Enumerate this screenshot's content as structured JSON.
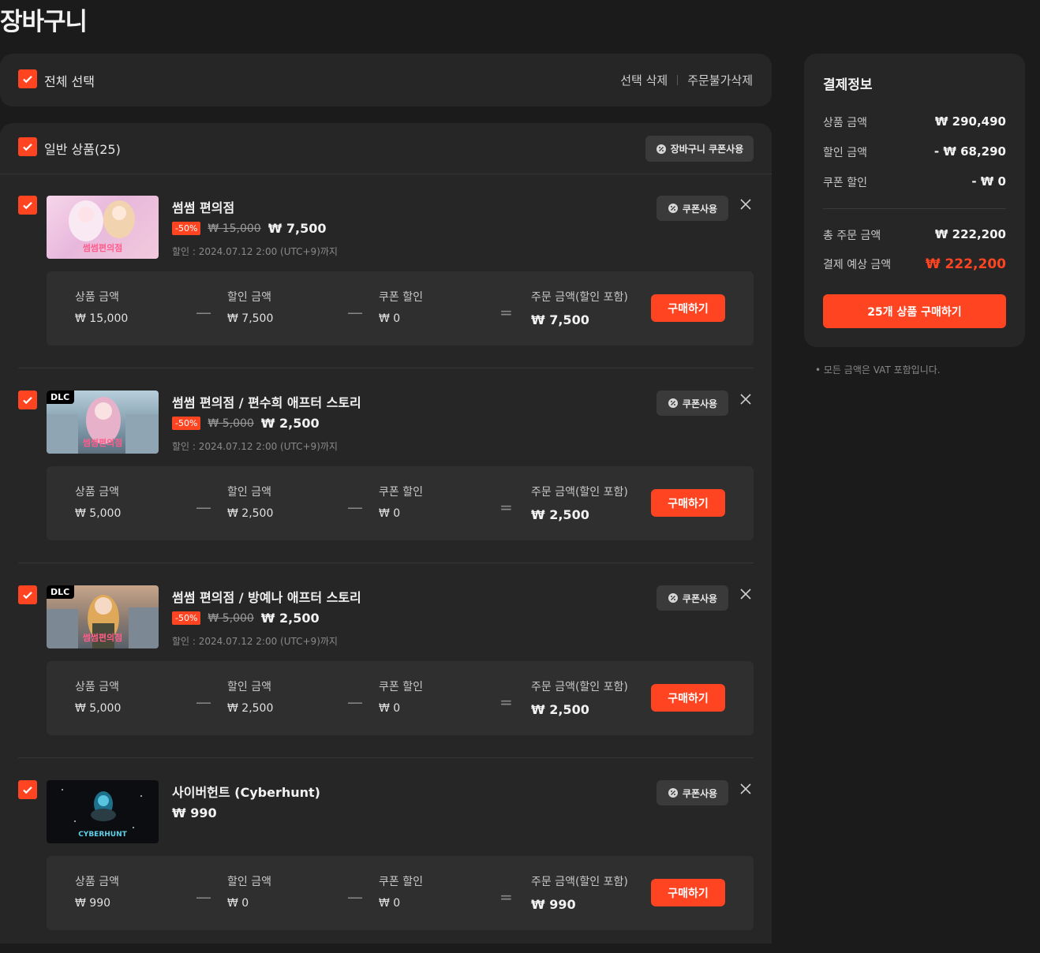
{
  "page": {
    "title": "장바구니"
  },
  "select_bar": {
    "select_all": "전체 선택",
    "delete_selected": "선택 삭제",
    "delete_unavailable": "주문불가삭제"
  },
  "group": {
    "label": "일반 상품(25)",
    "cart_coupon": "장바구니 쿠폰사용"
  },
  "item_labels": {
    "coupon_use": "쿠폰사용",
    "price_key": "상품 금액",
    "discount_key": "할인 금액",
    "coupon_key": "쿠폰 할인",
    "order_key": "주문 금액(할인 포함)",
    "buy": "구매하기"
  },
  "items": [
    {
      "dlc": "",
      "thumb_caption": "썸썸편의점",
      "name": "썸썸 편의점",
      "discount": "-50%",
      "original": "₩ 15,000",
      "final": "₩ 7,500",
      "until": "할인 : 2024.07.12 2:00 (UTC+9)까지",
      "price": "₩ 15,000",
      "discount_amount": "₩ 7,500",
      "coupon_amount": "₩ 0",
      "order_amount": "₩ 7,500"
    },
    {
      "dlc": "DLC",
      "thumb_caption": "썸썸편의점",
      "name": "썸썸 편의점 / 편수희 애프터 스토리",
      "discount": "-50%",
      "original": "₩ 5,000",
      "final": "₩ 2,500",
      "until": "할인 : 2024.07.12 2:00 (UTC+9)까지",
      "price": "₩ 5,000",
      "discount_amount": "₩ 2,500",
      "coupon_amount": "₩ 0",
      "order_amount": "₩ 2,500"
    },
    {
      "dlc": "DLC",
      "thumb_caption": "썸썸편의점",
      "name": "썸썸 편의점 / 방예나 애프터 스토리",
      "discount": "-50%",
      "original": "₩ 5,000",
      "final": "₩ 2,500",
      "until": "할인 : 2024.07.12 2:00 (UTC+9)까지",
      "price": "₩ 5,000",
      "discount_amount": "₩ 2,500",
      "coupon_amount": "₩ 0",
      "order_amount": "₩ 2,500"
    },
    {
      "dlc": "",
      "thumb_caption": "CYBERHUNT",
      "name": "사이버헌트 (Cyberhunt)",
      "discount": "",
      "original": "",
      "final": "₩ 990",
      "until": "",
      "price": "₩ 990",
      "discount_amount": "₩ 0",
      "coupon_amount": "₩ 0",
      "order_amount": "₩ 990"
    }
  ],
  "payment": {
    "title": "결제정보",
    "product_label": "상품 금액",
    "product_value": "₩ 290,490",
    "discount_label": "할인 금액",
    "discount_value": "- ₩ 68,290",
    "coupon_label": "쿠폰 할인",
    "coupon_value": "- ₩ 0",
    "total_label": "총 주문 금액",
    "total_value": "₩ 222,200",
    "expected_label": "결제 예상 금액",
    "expected_value": "₩ 222,200",
    "buy_all": "25개 상품 구매하기"
  },
  "vat_note": "• 모든 금액은 VAT 포함입니다.",
  "colors": {
    "accent": "#ff4422",
    "background": "#1b1b1b",
    "panel": "#262626"
  }
}
